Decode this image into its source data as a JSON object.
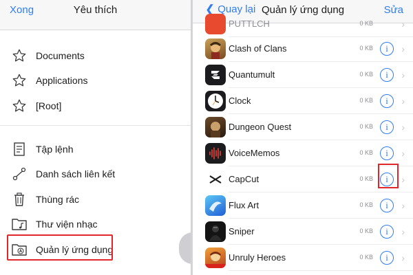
{
  "left": {
    "nav": {
      "done_label": "Xong",
      "title": "Yêu thích"
    },
    "favorites": [
      {
        "label": "Documents",
        "icon": "star-icon"
      },
      {
        "label": "Applications",
        "icon": "star-icon"
      },
      {
        "label": "[Root]",
        "icon": "star-icon"
      }
    ],
    "tools": [
      {
        "label": "Tập lệnh",
        "icon": "script-icon"
      },
      {
        "label": "Danh sách liên kết",
        "icon": "link-list-icon"
      },
      {
        "label": "Thùng rác",
        "icon": "trash-icon"
      },
      {
        "label": "Thư viện nhạc",
        "icon": "music-folder-icon"
      },
      {
        "label": "Quản lý ứng dụng",
        "icon": "app-manager-folder-icon"
      }
    ]
  },
  "right": {
    "nav": {
      "back_label": "Quay lại",
      "title": "Quản lý ứng dụng",
      "edit_label": "Sửa"
    },
    "partial_top": {
      "name": "PUTTLCH",
      "size": "0 KB"
    },
    "apps": [
      {
        "name": "Clash of Clans",
        "size": "0 KB",
        "icon": "clash-of-clans-icon"
      },
      {
        "name": "Quantumult",
        "size": "0 KB",
        "icon": "quantumult-icon"
      },
      {
        "name": "Clock",
        "size": "0 KB",
        "icon": "clock-icon"
      },
      {
        "name": "Dungeon Quest",
        "size": "0 KB",
        "icon": "dungeon-quest-icon"
      },
      {
        "name": "VoiceMemos",
        "size": "0 KB",
        "icon": "voice-memos-icon"
      },
      {
        "name": "CapCut",
        "size": "0 KB",
        "icon": "capcut-icon"
      },
      {
        "name": "Flux Art",
        "size": "0 KB",
        "icon": "flux-art-icon"
      },
      {
        "name": "Sniper",
        "size": "0 KB",
        "icon": "sniper-icon"
      },
      {
        "name": "Unruly Heroes",
        "size": "0 KB",
        "icon": "unruly-heroes-icon"
      }
    ],
    "info_glyph": "i",
    "chevron_glyph": "›"
  },
  "colors": {
    "accent": "#2f7cf6",
    "highlight": "#e0262b"
  }
}
